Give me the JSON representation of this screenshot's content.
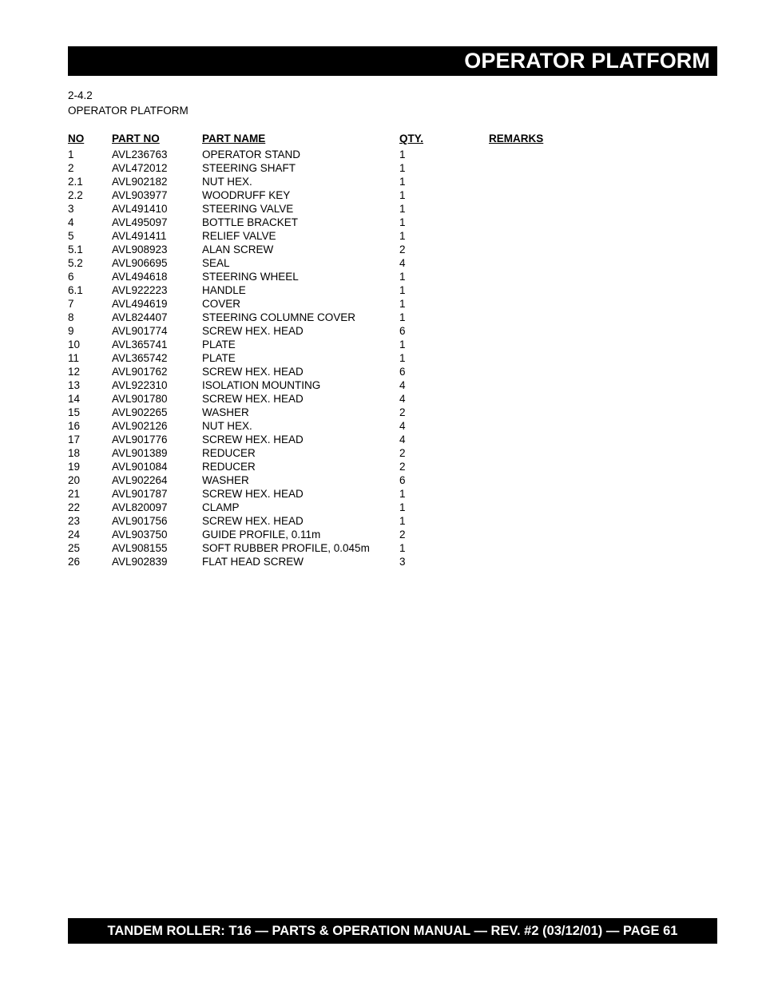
{
  "header": {
    "title": "OPERATOR PLATFORM"
  },
  "section": {
    "number": "2-4.2",
    "name": "OPERATOR PLATFORM"
  },
  "table": {
    "columns": {
      "no": "NO",
      "part_no": "PART NO",
      "part_name": "PART NAME",
      "qty": "QTY.",
      "remarks": "REMARKS"
    },
    "rows": [
      {
        "no": "1",
        "part_no": "AVL236763",
        "part_name": "OPERATOR STAND",
        "qty": "1",
        "remarks": ""
      },
      {
        "no": "2",
        "part_no": "AVL472012",
        "part_name": "STEERING SHAFT",
        "qty": "1",
        "remarks": ""
      },
      {
        "no": "2.1",
        "part_no": "AVL902182",
        "part_name": "NUT HEX.",
        "qty": "1",
        "remarks": ""
      },
      {
        "no": "2.2",
        "part_no": "AVL903977",
        "part_name": "WOODRUFF KEY",
        "qty": "1",
        "remarks": ""
      },
      {
        "no": "3",
        "part_no": "AVL491410",
        "part_name": "STEERING VALVE",
        "qty": "1",
        "remarks": ""
      },
      {
        "no": "4",
        "part_no": "AVL495097",
        "part_name": "BOTTLE BRACKET",
        "qty": "1",
        "remarks": ""
      },
      {
        "no": "5",
        "part_no": "AVL491411",
        "part_name": "RELIEF VALVE",
        "qty": "1",
        "remarks": ""
      },
      {
        "no": "5.1",
        "part_no": "AVL908923",
        "part_name": "ALAN SCREW",
        "qty": "2",
        "remarks": ""
      },
      {
        "no": "5.2",
        "part_no": "AVL906695",
        "part_name": "SEAL",
        "qty": "4",
        "remarks": ""
      },
      {
        "no": "6",
        "part_no": "AVL494618",
        "part_name": "STEERING WHEEL",
        "qty": "1",
        "remarks": ""
      },
      {
        "no": "6.1",
        "part_no": "AVL922223",
        "part_name": "HANDLE",
        "qty": "1",
        "remarks": ""
      },
      {
        "no": "7",
        "part_no": "AVL494619",
        "part_name": "COVER",
        "qty": "1",
        "remarks": ""
      },
      {
        "no": "8",
        "part_no": "AVL824407",
        "part_name": "STEERING COLUMNE COVER",
        "qty": "1",
        "remarks": ""
      },
      {
        "no": "9",
        "part_no": "AVL901774",
        "part_name": "SCREW HEX. HEAD",
        "qty": "6",
        "remarks": ""
      },
      {
        "no": "10",
        "part_no": "AVL365741",
        "part_name": "PLATE",
        "qty": "1",
        "remarks": ""
      },
      {
        "no": "11",
        "part_no": "AVL365742",
        "part_name": "PLATE",
        "qty": "1",
        "remarks": ""
      },
      {
        "no": "12",
        "part_no": "AVL901762",
        "part_name": "SCREW HEX. HEAD",
        "qty": "6",
        "remarks": ""
      },
      {
        "no": "13",
        "part_no": "AVL922310",
        "part_name": "ISOLATION MOUNTING",
        "qty": "4",
        "remarks": ""
      },
      {
        "no": "14",
        "part_no": "AVL901780",
        "part_name": "SCREW HEX. HEAD",
        "qty": "4",
        "remarks": ""
      },
      {
        "no": "15",
        "part_no": "AVL902265",
        "part_name": "WASHER",
        "qty": "2",
        "remarks": ""
      },
      {
        "no": "16",
        "part_no": "AVL902126",
        "part_name": "NUT HEX.",
        "qty": "4",
        "remarks": ""
      },
      {
        "no": "17",
        "part_no": "AVL901776",
        "part_name": "SCREW HEX. HEAD",
        "qty": "4",
        "remarks": ""
      },
      {
        "no": "18",
        "part_no": "AVL901389",
        "part_name": "REDUCER",
        "qty": "2",
        "remarks": ""
      },
      {
        "no": "19",
        "part_no": "AVL901084",
        "part_name": "REDUCER",
        "qty": "2",
        "remarks": ""
      },
      {
        "no": "20",
        "part_no": "AVL902264",
        "part_name": "WASHER",
        "qty": "6",
        "remarks": ""
      },
      {
        "no": "21",
        "part_no": "AVL901787",
        "part_name": "SCREW HEX. HEAD",
        "qty": "1",
        "remarks": ""
      },
      {
        "no": "22",
        "part_no": "AVL820097",
        "part_name": "CLAMP",
        "qty": "1",
        "remarks": ""
      },
      {
        "no": "23",
        "part_no": "AVL901756",
        "part_name": "SCREW HEX. HEAD",
        "qty": "1",
        "remarks": ""
      },
      {
        "no": "24",
        "part_no": "AVL903750",
        "part_name": "GUIDE PROFILE, 0.11m",
        "qty": "2",
        "remarks": ""
      },
      {
        "no": "25",
        "part_no": "AVL908155",
        "part_name": "SOFT RUBBER PROFILE, 0.045m",
        "qty": "1",
        "remarks": ""
      },
      {
        "no": "26",
        "part_no": "AVL902839",
        "part_name": "FLAT HEAD SCREW",
        "qty": "3",
        "remarks": ""
      }
    ]
  },
  "footer": {
    "text": "TANDEM ROLLER: T16 — PARTS & OPERATION MANUAL — REV. #2 (03/12/01) — PAGE 61"
  }
}
